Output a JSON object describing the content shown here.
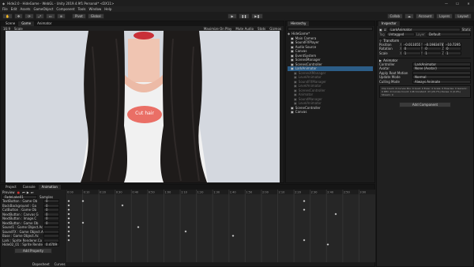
{
  "title": "Hide2.0 - HideGame - WebGL - Unity 2019.4.9f1 Personal* <DX11>",
  "menus": [
    "File",
    "Edit",
    "Assets",
    "GameObject",
    "Component",
    "Tools",
    "Window",
    "Help"
  ],
  "toolbar": {
    "pivot": "Pivot",
    "global": "Global",
    "collab": "Collab",
    "account": "Account",
    "layers": "Layers",
    "layout": "Layout"
  },
  "scene_tabs": [
    "Scene",
    "Game",
    "Animator"
  ],
  "game_bar": {
    "display": "16:9",
    "scale": "Scale",
    "opts": [
      "Maximize On Play",
      "Mute Audio",
      "Stats",
      "Gizmos"
    ]
  },
  "game": {
    "label": "Cut hair",
    "bg": "#d5d9e0",
    "hair": "#1d1a19",
    "shirt": "#f1f1f1",
    "label_bg": "#e96f67"
  },
  "hierarchy": {
    "title": "Hierarchy",
    "scene": "HideGame*",
    "items": [
      {
        "name": "Main Camera",
        "indent": 1,
        "dim": false,
        "sel": false
      },
      {
        "name": "SoundFXPlayer",
        "indent": 1,
        "dim": false,
        "sel": false
      },
      {
        "name": "Audio Source",
        "indent": 1,
        "dim": false,
        "sel": false
      },
      {
        "name": "Canvas",
        "indent": 1,
        "dim": false,
        "sel": false
      },
      {
        "name": "EventSystem",
        "indent": 1,
        "dim": false,
        "sel": false
      },
      {
        "name": "ScenesManager",
        "indent": 1,
        "dim": false,
        "sel": false
      },
      {
        "name": "ScenesController",
        "indent": 1,
        "dim": false,
        "sel": false
      },
      {
        "name": "LarkAnimator",
        "indent": 1,
        "dim": false,
        "sel": true
      },
      {
        "name": "ScenesXManager",
        "indent": 2,
        "dim": true,
        "sel": false
      },
      {
        "name": "LevelAnimator",
        "indent": 2,
        "dim": true,
        "sel": false
      },
      {
        "name": "SoundFXManager",
        "indent": 2,
        "dim": true,
        "sel": false
      },
      {
        "name": "LevelAnimator",
        "indent": 2,
        "dim": true,
        "sel": false
      },
      {
        "name": "ScenesController",
        "indent": 2,
        "dim": true,
        "sel": false
      },
      {
        "name": "Animator",
        "indent": 2,
        "dim": true,
        "sel": false
      },
      {
        "name": "SoundManager",
        "indent": 2,
        "dim": true,
        "sel": false
      },
      {
        "name": "LevelAnimator",
        "indent": 2,
        "dim": true,
        "sel": false
      },
      {
        "name": "SceneController",
        "indent": 1,
        "dim": false,
        "sel": false
      },
      {
        "name": "Canvas",
        "indent": 1,
        "dim": false,
        "sel": false
      }
    ]
  },
  "inspector": {
    "title": "Inspector",
    "obj": "LarkAnimator",
    "static": "Static",
    "tag": "Untagged",
    "layer": "Default",
    "transform": "Transform",
    "position": [
      "-0.011055",
      "-0.1983478",
      "-10.7295"
    ],
    "rotation": [
      "0",
      "0",
      "0"
    ],
    "scale": [
      "1",
      "1",
      "1"
    ],
    "animator": "Animator",
    "fields": [
      {
        "k": "Controller",
        "v": "LarkAnimator"
      },
      {
        "k": "Avatar",
        "v": "None (Avatar)"
      },
      {
        "k": "Apply Root Motion",
        "v": ""
      },
      {
        "k": "Update Mode",
        "v": "Normal"
      },
      {
        "k": "Culling Mode",
        "v": "Always Animate"
      }
    ],
    "info": "Clip Count: 6  Curves Pos: 0 Quat: 0 Euler: 0 Scale: 0 Muscles: 0 Generic: 0 PPtr: 0  Curves Count: 146 Constant: 43 (29.7%) Dense: 0 (0.0%) Stream: 0",
    "add_component": "Add Component"
  },
  "animation": {
    "tabs": [
      "Project",
      "Console",
      "Animation"
    ],
    "preview": "Preview",
    "clip": "FadeLake01",
    "samples": "Samples",
    "props": [
      "TextButton : Game Ob",
      "BackBackground : Ga",
      "CutButton : Game Ob",
      "NextButton : Canvas G",
      "NextButton : Image.C",
      "NextButton : Game Ob",
      "Sound1 : Game Object.Ac",
      "SoundFX : Game Object.Ac",
      "Base : Game Object.Ac",
      "Lark : Sprite Renderer.Co",
      "Hide02_01 : Sprite Rende"
    ],
    "values": [
      "0",
      "0",
      "0",
      "0",
      "0",
      "0",
      "",
      "",
      "",
      "",
      "0.4709"
    ],
    "add_property": "Add Property",
    "bottom_tabs": [
      "Dopesheet",
      "Curves"
    ],
    "ruler": [
      "0:00",
      "0:10",
      "0:20",
      "0:30",
      "0:40",
      "0:50",
      "1:00",
      "1:10",
      "1:20",
      "1:30",
      "1:40",
      "1:50",
      "2:00",
      "2:10",
      "2:20",
      "2:30",
      "2:40",
      "2:50",
      "3:00"
    ]
  }
}
